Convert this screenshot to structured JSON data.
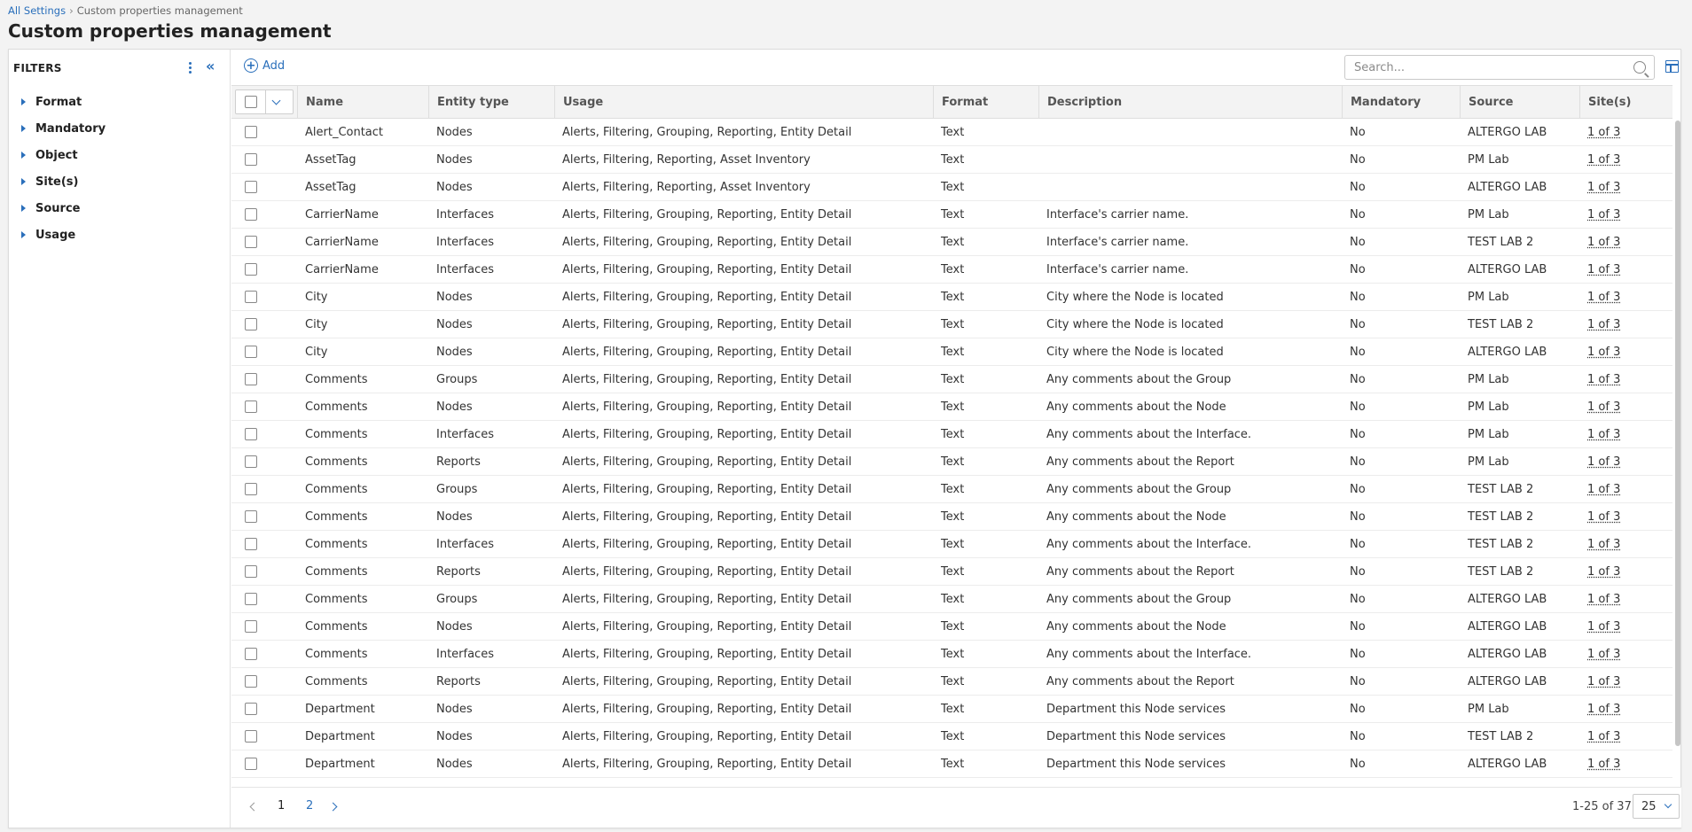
{
  "breadcrumb": {
    "link": "All Settings",
    "separator": "›",
    "current": "Custom properties management"
  },
  "page_title": "Custom properties management",
  "filters": {
    "title": "FILTERS",
    "items": [
      "Format",
      "Mandatory",
      "Object",
      "Site(s)",
      "Source",
      "Usage"
    ]
  },
  "toolbar": {
    "add_label": "Add",
    "search_placeholder": "Search..."
  },
  "table": {
    "columns": [
      "Name",
      "Entity type",
      "Usage",
      "Format",
      "Description",
      "Mandatory",
      "Source",
      "Site(s)"
    ],
    "rows": [
      [
        "Alert_Contact",
        "Nodes",
        "Alerts, Filtering, Grouping, Reporting, Entity Detail",
        "Text",
        "",
        "No",
        "ALTERGO LAB",
        "1 of 3"
      ],
      [
        "AssetTag",
        "Nodes",
        "Alerts, Filtering, Reporting, Asset Inventory",
        "Text",
        "",
        "No",
        "PM Lab",
        "1 of 3"
      ],
      [
        "AssetTag",
        "Nodes",
        "Alerts, Filtering, Reporting, Asset Inventory",
        "Text",
        "",
        "No",
        "ALTERGO LAB",
        "1 of 3"
      ],
      [
        "CarrierName",
        "Interfaces",
        "Alerts, Filtering, Grouping, Reporting, Entity Detail",
        "Text",
        "Interface's carrier name.",
        "No",
        "PM Lab",
        "1 of 3"
      ],
      [
        "CarrierName",
        "Interfaces",
        "Alerts, Filtering, Grouping, Reporting, Entity Detail",
        "Text",
        "Interface's carrier name.",
        "No",
        "TEST LAB 2",
        "1 of 3"
      ],
      [
        "CarrierName",
        "Interfaces",
        "Alerts, Filtering, Grouping, Reporting, Entity Detail",
        "Text",
        "Interface's carrier name.",
        "No",
        "ALTERGO LAB",
        "1 of 3"
      ],
      [
        "City",
        "Nodes",
        "Alerts, Filtering, Grouping, Reporting, Entity Detail",
        "Text",
        "City where the Node is located",
        "No",
        "PM Lab",
        "1 of 3"
      ],
      [
        "City",
        "Nodes",
        "Alerts, Filtering, Grouping, Reporting, Entity Detail",
        "Text",
        "City where the Node is located",
        "No",
        "TEST LAB 2",
        "1 of 3"
      ],
      [
        "City",
        "Nodes",
        "Alerts, Filtering, Grouping, Reporting, Entity Detail",
        "Text",
        "City where the Node is located",
        "No",
        "ALTERGO LAB",
        "1 of 3"
      ],
      [
        "Comments",
        "Groups",
        "Alerts, Filtering, Grouping, Reporting, Entity Detail",
        "Text",
        "Any comments about the Group",
        "No",
        "PM Lab",
        "1 of 3"
      ],
      [
        "Comments",
        "Nodes",
        "Alerts, Filtering, Grouping, Reporting, Entity Detail",
        "Text",
        "Any comments about the Node",
        "No",
        "PM Lab",
        "1 of 3"
      ],
      [
        "Comments",
        "Interfaces",
        "Alerts, Filtering, Grouping, Reporting, Entity Detail",
        "Text",
        "Any comments about the Interface.",
        "No",
        "PM Lab",
        "1 of 3"
      ],
      [
        "Comments",
        "Reports",
        "Alerts, Filtering, Grouping, Reporting, Entity Detail",
        "Text",
        "Any comments about the Report",
        "No",
        "PM Lab",
        "1 of 3"
      ],
      [
        "Comments",
        "Groups",
        "Alerts, Filtering, Grouping, Reporting, Entity Detail",
        "Text",
        "Any comments about the Group",
        "No",
        "TEST LAB 2",
        "1 of 3"
      ],
      [
        "Comments",
        "Nodes",
        "Alerts, Filtering, Grouping, Reporting, Entity Detail",
        "Text",
        "Any comments about the Node",
        "No",
        "TEST LAB 2",
        "1 of 3"
      ],
      [
        "Comments",
        "Interfaces",
        "Alerts, Filtering, Grouping, Reporting, Entity Detail",
        "Text",
        "Any comments about the Interface.",
        "No",
        "TEST LAB 2",
        "1 of 3"
      ],
      [
        "Comments",
        "Reports",
        "Alerts, Filtering, Grouping, Reporting, Entity Detail",
        "Text",
        "Any comments about the Report",
        "No",
        "TEST LAB 2",
        "1 of 3"
      ],
      [
        "Comments",
        "Groups",
        "Alerts, Filtering, Grouping, Reporting, Entity Detail",
        "Text",
        "Any comments about the Group",
        "No",
        "ALTERGO LAB",
        "1 of 3"
      ],
      [
        "Comments",
        "Nodes",
        "Alerts, Filtering, Grouping, Reporting, Entity Detail",
        "Text",
        "Any comments about the Node",
        "No",
        "ALTERGO LAB",
        "1 of 3"
      ],
      [
        "Comments",
        "Interfaces",
        "Alerts, Filtering, Grouping, Reporting, Entity Detail",
        "Text",
        "Any comments about the Interface.",
        "No",
        "ALTERGO LAB",
        "1 of 3"
      ],
      [
        "Comments",
        "Reports",
        "Alerts, Filtering, Grouping, Reporting, Entity Detail",
        "Text",
        "Any comments about the Report",
        "No",
        "ALTERGO LAB",
        "1 of 3"
      ],
      [
        "Department",
        "Nodes",
        "Alerts, Filtering, Grouping, Reporting, Entity Detail",
        "Text",
        "Department this Node services",
        "No",
        "PM Lab",
        "1 of 3"
      ],
      [
        "Department",
        "Nodes",
        "Alerts, Filtering, Grouping, Reporting, Entity Detail",
        "Text",
        "Department this Node services",
        "No",
        "TEST LAB 2",
        "1 of 3"
      ],
      [
        "Department",
        "Nodes",
        "Alerts, Filtering, Grouping, Reporting, Entity Detail",
        "Text",
        "Department this Node services",
        "No",
        "ALTERGO LAB",
        "1 of 3"
      ]
    ]
  },
  "pagination": {
    "pages": [
      "1",
      "2"
    ],
    "current_page": "1",
    "range": "1-25 of 37",
    "per_page": "25"
  },
  "colors": {
    "accent": "#2a6fbb",
    "header_bg": "#f3f3f3",
    "page_bg": "#f3f3f3"
  },
  "icons": {
    "kebab": "kebab-menu-icon",
    "collapse": "double-chevron-left-icon",
    "add": "plus-circle-icon",
    "search": "search-icon",
    "columns": "column-settings-icon"
  }
}
